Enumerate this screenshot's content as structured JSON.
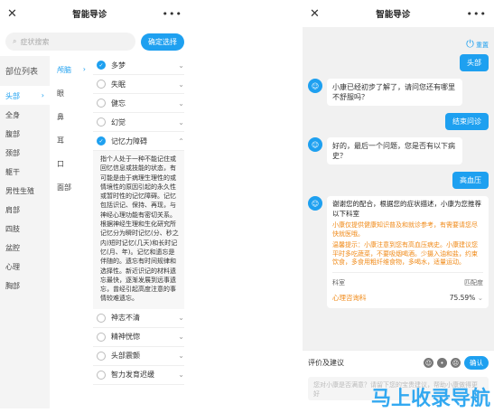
{
  "left": {
    "title": "智能导诊",
    "close": "✕",
    "more": "•••",
    "search_placeholder": "症状搜索",
    "confirm": "确定选择",
    "parts_header": "部位列表",
    "parts": [
      "头部",
      "全身",
      "腹部",
      "颈部",
      "躯干",
      "男性生殖",
      "肩部",
      "四肢",
      "盆腔",
      "心理",
      "胸部"
    ],
    "subparts": [
      "颅脑",
      "眼",
      "鼻",
      "耳",
      "口",
      "面部"
    ],
    "symptoms_top": [
      "多梦",
      "失眠",
      "健忘",
      "幻觉"
    ],
    "expanded": "记忆力障碍",
    "description": "指个人处于一种不能记住或回忆信息或技能的状态，有可能是由于病理生理性的或情境性的原因引起的永久性或暂时性的记忆障碍。记忆包括识记、保持、再现，与神经心理功能有密切关系。根据神经生理和生化研究所记忆分为瞬时记忆(分、秒之内)短时记忆(几天)和长时记忆(月、年)。记忆和遗忘是伴随的。遗忘有时间规律和选择性。新近识记的材料遗忘最快，逐渐发展到远事遗忘，曾经引起高度注意的事情较难遗忘。",
    "symptoms_bottom": [
      "神志不清",
      "精神恍惚",
      "头部震颤",
      "智力发育迟缓"
    ]
  },
  "right": {
    "title": "智能导诊",
    "close": "✕",
    "more": "•••",
    "reset": "重置",
    "top_tag": "头部",
    "q1": "小康已经初步了解了，请问您还有哪里不舒服吗？",
    "a1": "结束问诊",
    "q2": "好的，最后一个问题，您是否有以下病史？",
    "a2": "高血压",
    "result_intro": "谢谢您的配合，根据您的症状描述，小康为您推荐以下科室",
    "note1": "小康仅提供健康知识普及和就诊参考，有需要请您尽快就医哦。",
    "note2": "温馨提示：小康注意到您有高血压病史。小康建议您平时多吃蔬菜，不要吸烟喝酒。少摄入油和盐，约束饮食，多食用粗纤维食物，多喝水，适量运动。",
    "col_dept": "科室",
    "col_match": "匹配度",
    "dept": "心理咨询科",
    "match": "75.59%",
    "feedback_label": "评价及建议",
    "feedback_ok": "确认",
    "feedback_placeholder": "您对小康是否满意？请留下您的宝贵建议，帮助小康做得更好",
    "watermark": "马上收录导航"
  }
}
